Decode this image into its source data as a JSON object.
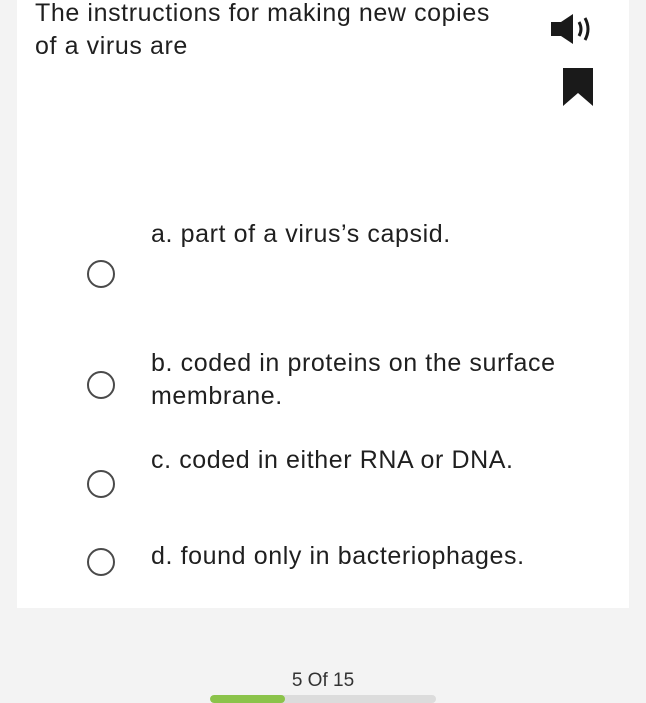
{
  "question": {
    "text": "The instructions for making new copies of a virus are"
  },
  "icons": {
    "audio": "speaker-icon",
    "bookmark": "bookmark-icon"
  },
  "options": [
    {
      "label": "a. part of a virus’s capsid."
    },
    {
      "label": "b. coded in proteins on the surface membrane."
    },
    {
      "label": "c. coded in either RNA or DNA."
    },
    {
      "label": "d. found only in bacteriophages."
    }
  ],
  "progress": {
    "label": "5 Of 15",
    "fraction": 0.333,
    "fill_color": "#8bc34a"
  }
}
